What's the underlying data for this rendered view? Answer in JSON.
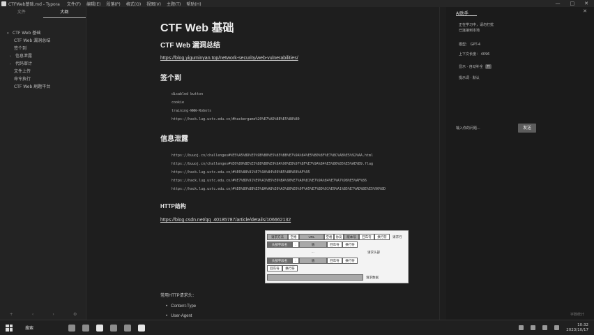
{
  "window": {
    "title": "CTFWeb基础.md - Typora",
    "menu": [
      "文件(F)",
      "编辑(E)",
      "段落(P)",
      "格式(O)",
      "视图(V)",
      "主题(T)",
      "帮助(H)"
    ],
    "controls": [
      "—",
      "□",
      "✕"
    ]
  },
  "sidebar": {
    "tabs": [
      "文件",
      "大纲"
    ],
    "outline": [
      {
        "label": "CTF Web 基础",
        "chevron": "▾",
        "level": 1
      },
      {
        "label": "CTF Web 漏洞总结",
        "chevron": "",
        "level": 2
      },
      {
        "label": "签个到",
        "chevron": "",
        "level": 2
      },
      {
        "label": "信息泄露",
        "chevron": "›",
        "level": 2
      },
      {
        "label": "代码审计",
        "chevron": "›",
        "level": 2
      },
      {
        "label": "文件上传",
        "chevron": "",
        "level": 2
      },
      {
        "label": "命令执行",
        "chevron": "",
        "level": 2
      },
      {
        "label": "CTF Web 刷题平台",
        "chevron": "",
        "level": 2
      }
    ],
    "footer": [
      "+",
      "‹",
      "›",
      "⚙"
    ]
  },
  "doc": {
    "h1": "CTF Web 基础",
    "h2_vuln": "CTF Web 漏洞总结",
    "link1": "https://blog.yiguminyan.top/network-security/web-vulnerabilities/",
    "h2_sign": "签个到",
    "sign_code": [
      "disabled button",
      "cookie",
      "training-WWW-Robots",
      "https://hack.lug.ustc.edu.cn/#hackergame%20%E7%AD%BE%E5%88%B0"
    ],
    "h2_leak": "信息泄露",
    "leak_code": [
      "https://buuoj.cn/challenges#%E5%A5%BD%E5%9B%B0%E5%85%BB%E7%9A%84%E5%B0%8F%E7%8C%AB%E5%92%AA.html",
      "https://buuoj.cn/challenges#%E6%89%BE%E5%88%B0%E9%9A%90%E8%97%8F%E7%9A%84%E5%86%85%E5%AE%B9.flag",
      "https://hack.lug.ustc.edu.cn/#%E6%88%91%E7%9A%84%E6%B5%8B%E8%AF%95",
      "https://hack.lug.ustc.edu.cn/#%E7%BD%91%E9%A1%B5%E6%BA%90%E7%A0%81%E7%9A%84%E7%A7%98%E5%AF%86",
      "https://hack.lug.ustc.edu.cn/#%E6%89%8B%E5%8A%A8%E6%A3%80%E6%9F%A5%E7%BD%91%E9%A1%B5%E7%AD%BE%E5%90%8D"
    ],
    "h3_http": "HTTP结构",
    "link2": "https://blog.csdn.net/qq_40185787/article/details/106662132",
    "diagram": {
      "row1": [
        "请求方法",
        "空格",
        "URL",
        "空格",
        "协议",
        "版本号",
        "回车符",
        "换行符",
        "请求行"
      ],
      "row2": [
        "头部字段名",
        ":",
        "值",
        "回车符",
        "换行符"
      ],
      "dots": "...",
      "row4": [
        "头部字段名",
        ":",
        "值",
        "回车符",
        "换行符"
      ],
      "row5": [
        "回车符",
        "换行符"
      ],
      "side_label": "请求头部",
      "body_label": "请求数据"
    },
    "para": "常用HTTP请求头：",
    "bullets": [
      "Content-Type",
      "User-Agent"
    ]
  },
  "rpanel": {
    "title": "AI助手",
    "close": "✕",
    "lines": [
      "正在学习中，请勿打扰",
      "已连接到本地"
    ],
    "status1": "模型：",
    "status1_val": "GPT-4",
    "status2": "上下文长度：",
    "status2_val": "4096",
    "option1": "显示 · 自动补全",
    "option1_badge": "开",
    "option2": "提示词 · 默认",
    "input_placeholder": "输入你的问题...",
    "send": "发送",
    "footer": "字数统计"
  },
  "taskbar": {
    "search": "搜索",
    "time": "10:32",
    "date": "2023/10/17"
  }
}
